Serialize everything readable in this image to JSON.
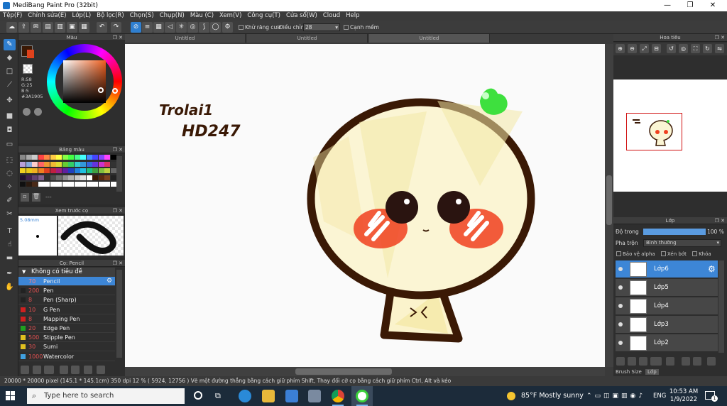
{
  "window": {
    "title": "MediBang Paint Pro (32bit)",
    "controls": [
      "—",
      "❐",
      "✕"
    ]
  },
  "menu": [
    "Tệp(F)",
    "Chỉnh sửa(E)",
    "Lớp(L)",
    "Bộ lọc(R)",
    "Chọn(S)",
    "Chụp(N)",
    "Màu (C)",
    "Xem(V)",
    "Công cụ(T)",
    "Cửa sổ(W)",
    "Cloud",
    "Help"
  ],
  "toolbar": {
    "antialias_label": "Khử răng cưa",
    "correction_label": "Điều chỉnh",
    "correction_value": "28",
    "soft_edge_label": "Cạnh mềm"
  },
  "doc_tabs": [
    "Untitled",
    "Untitled",
    "Untitled"
  ],
  "color_panel": {
    "title": "Màu",
    "r": "R:58",
    "g": "G:25",
    "b": "B:5",
    "hex": "#3A1905",
    "primary_color": "#3A1905",
    "secondary_color": "#E0421C"
  },
  "palette_panel": {
    "title": "Bảng màu",
    "more": "---"
  },
  "brush_preview_panel": {
    "title": "Xem trước cọ",
    "size": "5.08mm"
  },
  "brush_panel": {
    "title": "Cọ: Pencil",
    "group": "Không có tiêu đề",
    "items": [
      {
        "size": "70",
        "name": "Pencil",
        "color": "#3d86d6",
        "selected": true
      },
      {
        "size": "200",
        "name": "Pen",
        "color": "#222222"
      },
      {
        "size": "8",
        "name": "Pen (Sharp)",
        "color": "#222222"
      },
      {
        "size": "10",
        "name": "G Pen",
        "color": "#d02020"
      },
      {
        "size": "8",
        "name": "Mapping Pen",
        "color": "#d02020"
      },
      {
        "size": "20",
        "name": "Edge Pen",
        "color": "#20a020"
      },
      {
        "size": "500",
        "name": "Stipple Pen",
        "color": "#e0c020"
      },
      {
        "size": "30",
        "name": "Sumi",
        "color": "#e0c020"
      },
      {
        "size": "1000",
        "name": "Watercolor",
        "color": "#40a0e0"
      }
    ]
  },
  "canvas_text": {
    "line1": "Trolai1",
    "line2": "HD247"
  },
  "navigator_panel": {
    "title": "Hoa tiêu"
  },
  "layer_panel": {
    "title": "Lớp",
    "opacity_label": "Độ trong",
    "opacity_value": "100 %",
    "opacity": 1.0,
    "blend_label": "Pha trộn",
    "blend_value": "Bình thường",
    "protect_alpha": "Bảo vệ alpha",
    "clipping": "Xén bớt",
    "lock": "Khóa",
    "layers": [
      "Lớp6",
      "Lớp5",
      "Lớp4",
      "Lớp3",
      "Lớp2"
    ],
    "tabs": [
      "Brush Size",
      "Lớp"
    ]
  },
  "status": {
    "text": "20000 * 20000 pixel  (145.1 * 145.1cm)  350 dpi  12 %  ( 5924, 12756 )  Vẽ một đường thẳng bằng cách giữ phím Shift, Thay đổi cỡ cọ bằng cách giữ phím Ctrl, Alt và kéo"
  },
  "taskbar": {
    "search_placeholder": "Type here to search",
    "weather": "85°F  Mostly sunny",
    "lang": "ENG",
    "time": "10:53 AM",
    "date": "1/9/2022",
    "notif_count": "1"
  }
}
